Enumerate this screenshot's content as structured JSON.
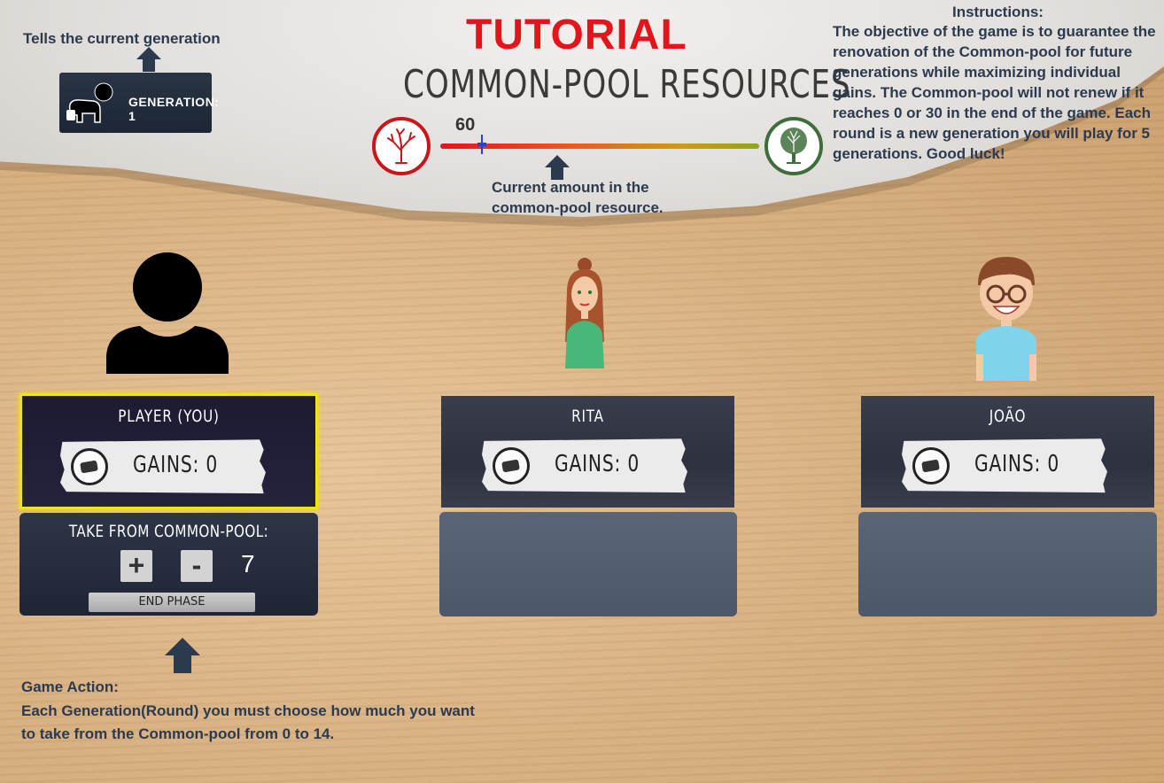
{
  "tutorial_title": "TUTORIAL",
  "game_title": "COMMON-POOL RESOURCES",
  "annotations": {
    "generation": "Tells the current generation",
    "pool": "Current amount in the common-pool resource.",
    "instructions_title": "Instructions:",
    "instructions_body": "The objective of the game is to guarantee the renovation of the Common-pool for future generations while maximizing individual gains. The Common-pool will not renew if it reaches 0 or 30 in the end of the game. Each round is a new generation you will play for 5 generations. Good luck!",
    "action_title": "Game Action:",
    "action_body": "Each Generation(Round) you must choose how much you want to take from the Common-pool from 0 to 14."
  },
  "generation_badge": {
    "label": "GENERATION: 1",
    "icon": "baby-crawling-icon"
  },
  "pool": {
    "value": "60",
    "level_fraction": 0.13,
    "low_icon": "dead-tree-icon",
    "high_icon": "healthy-tree-icon"
  },
  "players": [
    {
      "name": "PLAYER  (YOU)",
      "gains": "GAINS: 0",
      "avatar": "silhouette-avatar"
    },
    {
      "name": "RITA",
      "gains": "GAINS: 0",
      "avatar": "woman-avatar"
    },
    {
      "name": "JOÃO",
      "gains": "GAINS: 0",
      "avatar": "man-glasses-avatar"
    }
  ],
  "action_panel": {
    "label": "TAKE FROM COMMON-POOL:",
    "plus": "+",
    "minus": "-",
    "amount": "7",
    "end_phase": "END PHASE"
  },
  "colors": {
    "accent_red": "#e3141b",
    "highlight": "#f2e21a",
    "annotation": "#2b3a4e"
  }
}
